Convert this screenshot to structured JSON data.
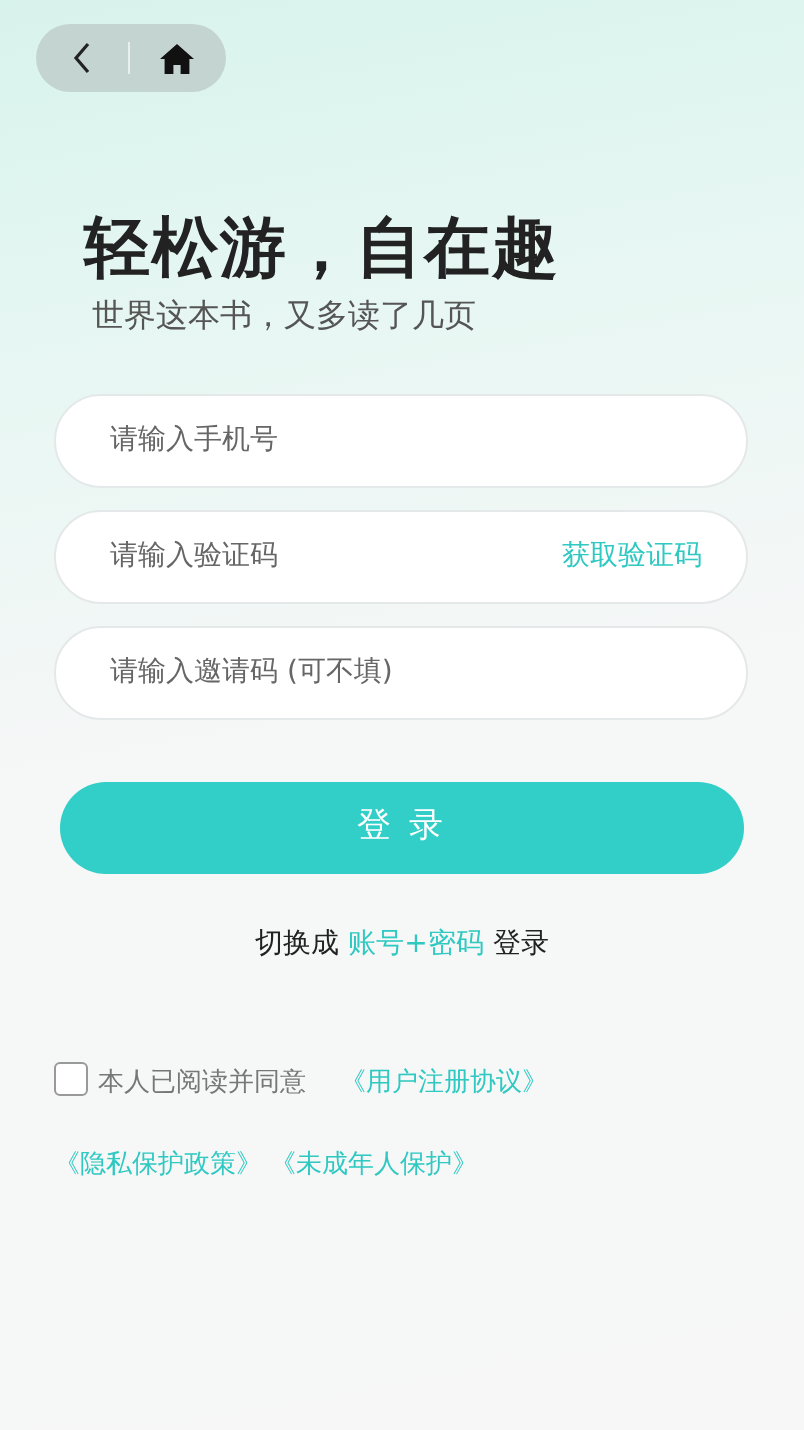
{
  "title": "轻松游，自在趣",
  "subtitle": "世界这本书，又多读了几页",
  "fields": [
    {
      "kind": "plain",
      "placeholder": "请输入手机号"
    },
    {
      "kind": "code",
      "placeholder": "请输入验证码",
      "action": "获取验证码"
    },
    {
      "kind": "plain",
      "placeholder": "请输入邀请码 (可不填)"
    }
  ],
  "login_button": "登 录",
  "switch": {
    "prefix": "切换成",
    "link": "账号+密码",
    "suffix": "登录"
  },
  "agreement": {
    "checked": false,
    "text": "本人已阅读并同意",
    "links": [
      "《用户注册协议》",
      "《隐私保护政策》",
      "《未成年人保护》"
    ]
  }
}
